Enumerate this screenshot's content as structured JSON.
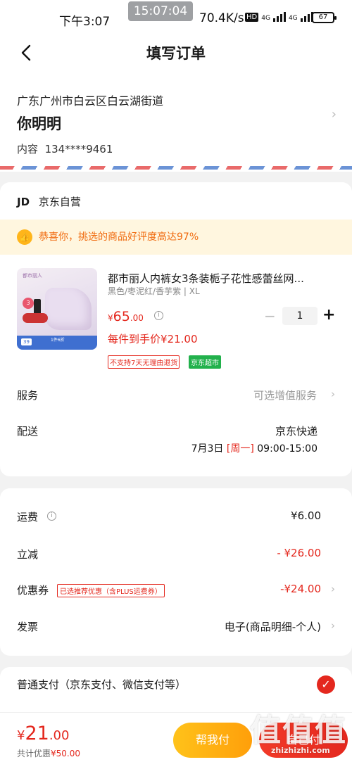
{
  "status_bar": {
    "time": "下午3:07",
    "clock": "15:07:04",
    "network_speed": "70.4K/s",
    "hd": "HD",
    "signal_1": "4G",
    "signal_2": "4G",
    "battery": "67"
  },
  "nav": {
    "title": "填写订单"
  },
  "address": {
    "line": "广东广州市白云区白云湖街道",
    "name": "你明明",
    "phone_label": "内容",
    "phone": "134****9461"
  },
  "shop": {
    "logo": "JD",
    "name": "京东自营",
    "praise": "恭喜你，挑选的商品好评度高达97%",
    "product": {
      "name": "都市丽人内裤女3条装栀子花性感蕾丝网...",
      "spec": "黑色/枣泥红/香芋紫 | XL",
      "price_symbol": "¥",
      "price_main": "65",
      "price_dec": ".00",
      "quantity": "1",
      "unit_price": "每件到手价¥21.00",
      "tag_no_return": "不支持7天无理由退货",
      "tag_market": "京东超市",
      "image_brand": "都市丽人",
      "image_price": "39",
      "image_deal": "1件6折",
      "image_badge": "3"
    },
    "service": {
      "label": "服务",
      "value": "可选增值服务"
    },
    "delivery": {
      "label": "配送",
      "value": "京东快递",
      "date": "7月3日",
      "weekday": "[周一]",
      "time": "09:00-15:00"
    }
  },
  "fees": {
    "shipping_label": "运费",
    "shipping_value": "¥6.00",
    "discount_label": "立减",
    "discount_value": "- ¥26.00",
    "coupon_label": "优惠券",
    "coupon_tag": "已选推荐优惠（含PLUS运费券）",
    "coupon_value": "-¥24.00",
    "invoice_label": "发票",
    "invoice_value": "电子(商品明细-个人)"
  },
  "payment": {
    "label": "普通支付（京东支付、微信支付等）"
  },
  "bottom": {
    "total_symbol": "¥",
    "total_main": "21",
    "total_dec": ".00",
    "saving_label": "共计优惠",
    "saving_value": "¥50.00",
    "help_button": "帮我付",
    "pay_button": "自己付"
  },
  "watermark": {
    "main": "值值值",
    "sub": "zhizhizhi.com"
  },
  "colors": {
    "accent": "#e4281e",
    "praise_bg": "#fff6df",
    "help": "#ffb213",
    "market": "#22b14c"
  }
}
